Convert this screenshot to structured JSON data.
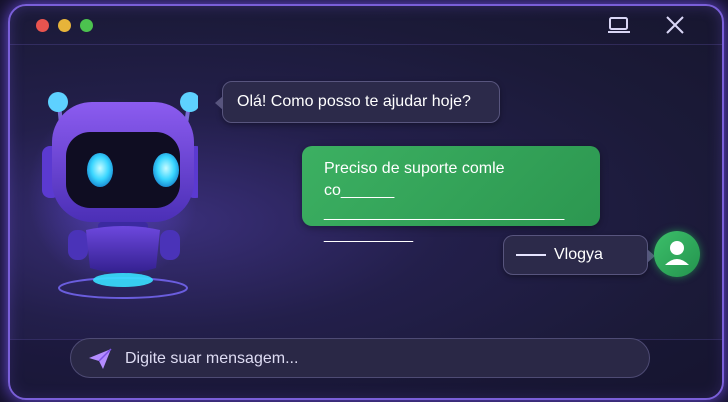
{
  "window": {
    "controls": [
      "close",
      "minimize",
      "maximize"
    ],
    "accent_color": "#7a5fd9"
  },
  "chat": {
    "bot_message": "Olá! Como posso te ajudar hoje?",
    "user_message": {
      "text": "Preciso de suporte comle co",
      "trailing_blank": "______",
      "line2": "___________________________",
      "line3": "__________"
    },
    "user_name": "Vlogya",
    "user_bubble_color": "#3cb062"
  },
  "input": {
    "placeholder": "Digite suar mensagem...",
    "value": ""
  },
  "icons": {
    "send": "send-icon",
    "avatar": "user-avatar-icon",
    "minimize": "window-minimize-icon",
    "close": "close-icon"
  }
}
